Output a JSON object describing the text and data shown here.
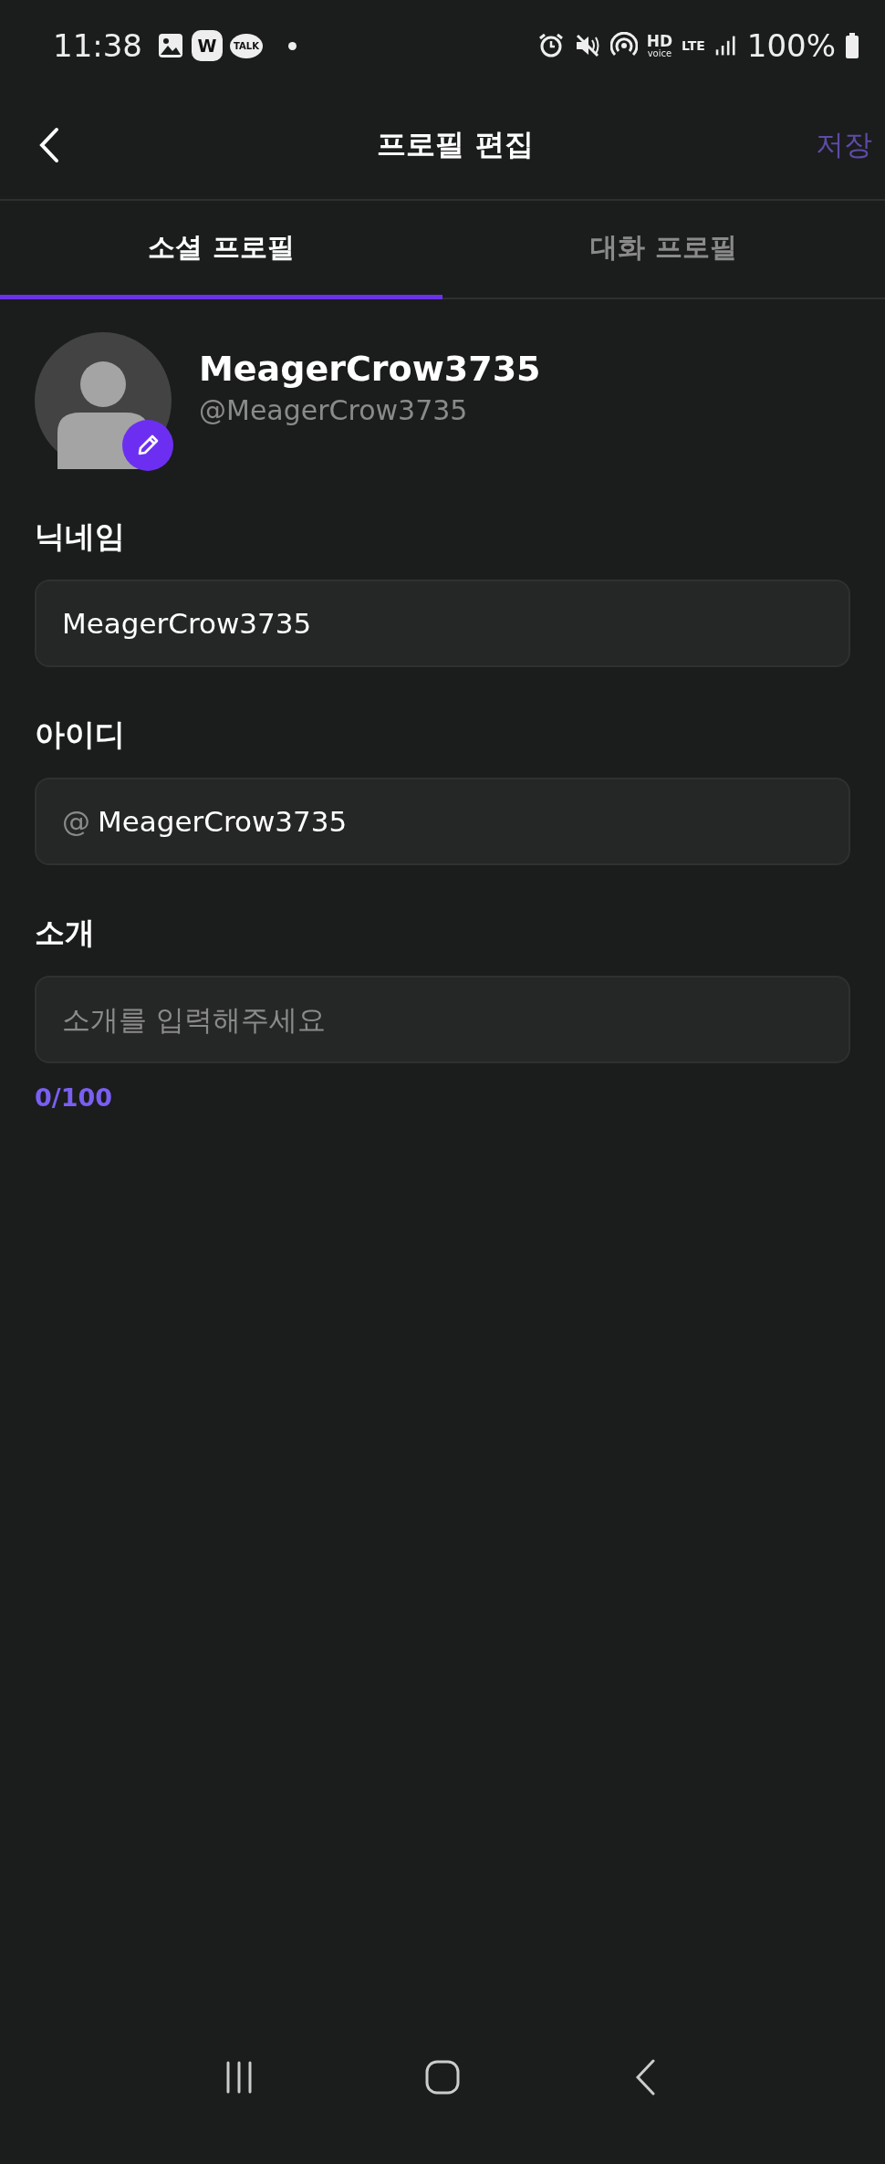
{
  "status_bar": {
    "time": "11:38",
    "app_badges": [
      {
        "kind": "gallery"
      },
      {
        "kind": "letter",
        "text": "W"
      },
      {
        "kind": "bubble",
        "text": "TALK"
      },
      {
        "kind": "dot"
      }
    ],
    "hd_top": "HD",
    "hd_bottom": "voice",
    "network": "LTE",
    "battery": "100%"
  },
  "header": {
    "title": "프로필 편집",
    "action": "저장"
  },
  "tabs": [
    {
      "label": "소셜 프로필",
      "selected": true
    },
    {
      "label": "대화 프로필",
      "selected": false
    }
  ],
  "profile": {
    "name": "MeagerCrow3735",
    "handle": "@MeagerCrow3735"
  },
  "fields": [
    {
      "kind": "text",
      "label": "닉네임",
      "value": "MeagerCrow3735"
    },
    {
      "kind": "handle",
      "label": "아이디",
      "prefix": "@",
      "value": "MeagerCrow3735"
    },
    {
      "kind": "text",
      "label": "소개",
      "placeholder": "소개를 입력해주세요"
    }
  ],
  "counter": "0/100"
}
